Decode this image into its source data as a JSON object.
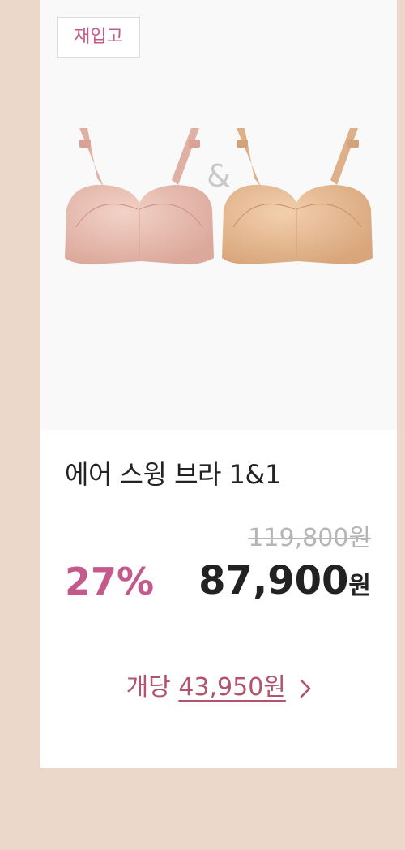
{
  "card": {
    "badge": "재입고",
    "ampersand": "&",
    "product_name": "에어 스윙 브라 1&1",
    "original_price": "119,800원",
    "discount": "27%",
    "sale_price_value": "87,900",
    "sale_price_unit": "원",
    "per_unit_label": "개당",
    "per_unit_price": "43,950원",
    "chevron_icon": "chevron-right-icon",
    "colors": {
      "accent": "#c45a8b",
      "per_unit": "#b3546f",
      "bra_left": "#e9bfb3",
      "bra_right": "#e8bf97",
      "background": "#ecd8cb"
    }
  }
}
